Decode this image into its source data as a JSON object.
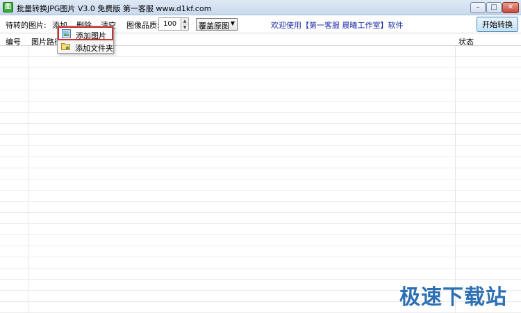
{
  "window": {
    "title": "批量转换JPG图片 V3.0 免费版     第一客服 www.d1kf.com",
    "icon_text": "图",
    "minimize_glyph": "–",
    "maximize_glyph": "□",
    "close_glyph": "✕"
  },
  "toolbar": {
    "pending_label": "待转的图片:",
    "menu_add": "添加",
    "menu_delete": "删除",
    "menu_clear": "清空",
    "quality_label": "图像品质:",
    "quality_value": "100",
    "spin_up": "▲",
    "spin_down": "▼",
    "overwrite_select": "覆盖原图",
    "select_arrow": "▼",
    "welcome": "欢迎使用【第一客服 晨曦工作室】软件",
    "start_button": "开始转换"
  },
  "table": {
    "columns": [
      "编号",
      "图片路径",
      "状态"
    ],
    "rows": []
  },
  "popup_menu": {
    "items": [
      {
        "label": "添加图片",
        "icon": "image-icon",
        "highlighted": true
      },
      {
        "label": "添加文件夹",
        "icon": "folder-icon",
        "highlighted": false
      }
    ]
  },
  "watermark": "极速下载站",
  "colors": {
    "link_text": "#1a2ba8",
    "highlight_border": "#d42d2d",
    "watermark": "#2d6fb3"
  }
}
